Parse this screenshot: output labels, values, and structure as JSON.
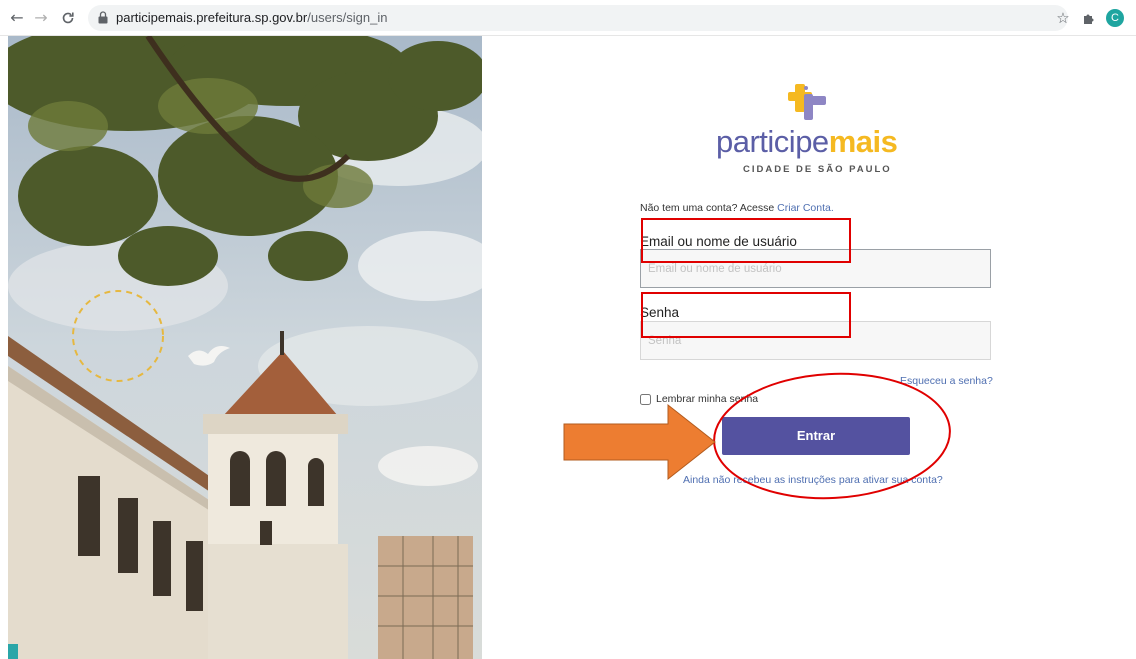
{
  "browser": {
    "back_icon": "←",
    "forward_icon": "→",
    "reload_icon": "C",
    "url_host": "participemais.prefeitura.sp.gov.br",
    "url_path": "/users/sign_in",
    "star_icon": "☆",
    "extensions_icon": "✱",
    "avatar_letter": "C"
  },
  "brand": {
    "word_part1": "participe",
    "word_part2": "mais",
    "subtitle": "CIDADE DE SÃO PAULO",
    "colors": {
      "purple": "#5b5ea6",
      "yellow": "#f5b921"
    }
  },
  "form": {
    "signup_prompt": "Não tem uma conta? Acesse",
    "signup_link": "Criar Conta.",
    "email_label": "Email ou nome de usuário",
    "email_placeholder": "Email ou nome de usuário",
    "password_label": "Senha",
    "password_placeholder": "Senha",
    "forgot_link": "Esqueceu a senha?",
    "remember_label": "Lembrar minha senha",
    "submit_label": "Entrar",
    "resend_link": "Ainda não recebeu as instruções para ativar sua conta?",
    "button_color": "#5452a0"
  },
  "annotations": {
    "highlight_color": "#e00000",
    "arrow_color": "#ed7d31"
  }
}
